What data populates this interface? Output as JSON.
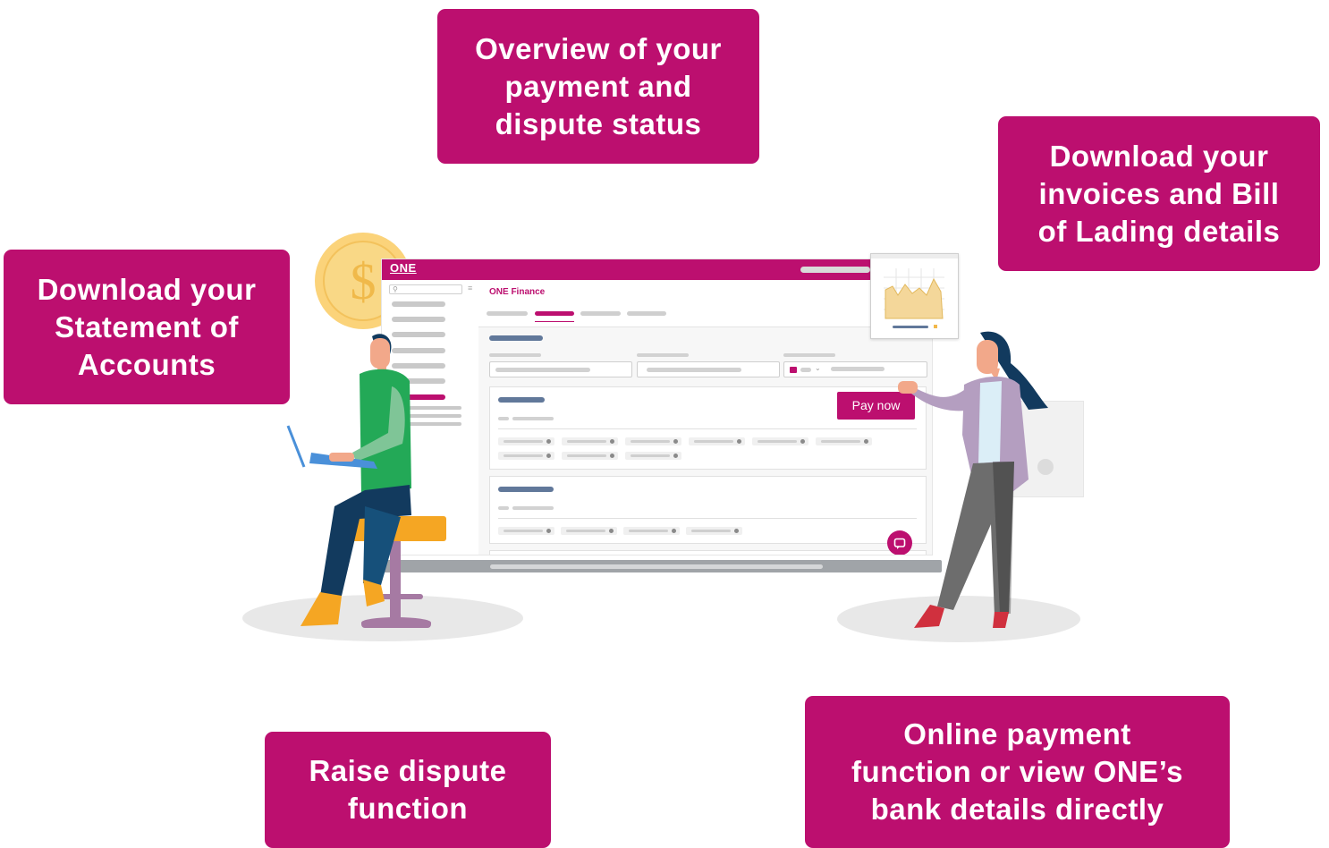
{
  "callouts": {
    "overview": "Overview of your\npayment and\ndispute status",
    "invoices": "Download your\ninvoices and Bill\nof Lading details",
    "statement": "Download your\nStatement of\nAccounts",
    "dispute": "Raise dispute\nfunction",
    "payment": "Online payment\nfunction or view ONE’s\nbank details directly"
  },
  "app": {
    "logo": "ONE",
    "page_title": "ONE Finance",
    "pay_button": "Pay now"
  },
  "icons": {
    "coin": "dollar-coin-icon",
    "search": "search-icon",
    "chat": "chat-icon",
    "chart": "area-chart-icon"
  },
  "colors": {
    "brand": "#bc0f6f",
    "muted_bar": "#61789a"
  }
}
